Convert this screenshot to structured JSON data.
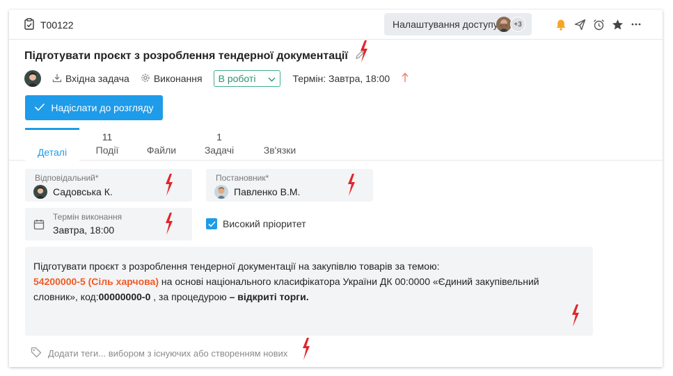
{
  "header": {
    "task_id": "T00122",
    "access_button": "Налаштування доступу",
    "access_more_count": "+3"
  },
  "task": {
    "title": "Підготувати проєкт з розроблення тендерної документації",
    "incoming": "Вхідна задача",
    "execution": "Виконання",
    "status": "В роботі",
    "deadline": "Термін: Завтра, 18:00",
    "submit_button": "Надіслати до розгляду"
  },
  "tabs": [
    {
      "label": "Деталі",
      "count": ""
    },
    {
      "label": "Події",
      "count": "11"
    },
    {
      "label": "Файли",
      "count": ""
    },
    {
      "label": "Задачі",
      "count": "1"
    },
    {
      "label": "Зв'язки",
      "count": ""
    }
  ],
  "fields": {
    "responsible_label": "Відповідальний*",
    "responsible_value": "Садовська К.",
    "author_label": "Постановник*",
    "author_value": "Павленко В.М.",
    "due_label": "Термін виконання",
    "due_value": "Завтра, 18:00",
    "priority_label": "Високий пріоритет"
  },
  "description": {
    "line1": "Підготувати проєкт з розроблення тендерної документації на закупівлю товарів за темою:",
    "code_highlight": "54200000-5 (Сіль харчова)",
    "text_after_code": " на основі національного класифікатора України ДК 00:0000 «Єдиний закупівельний словник», код:",
    "code2": "00000000-0",
    "text_mid": " , за процедурою ",
    "dash": "–",
    "procedure": " відкриті торги."
  },
  "tags_placeholder": "Додати теги... вибором з існуючих або створенням нових",
  "colors": {
    "accent": "#1e9be9",
    "status_green": "#27936f",
    "highlight_orange": "#f05a24",
    "bell_orange": "#f6a623",
    "marker_red": "#e0262b"
  }
}
